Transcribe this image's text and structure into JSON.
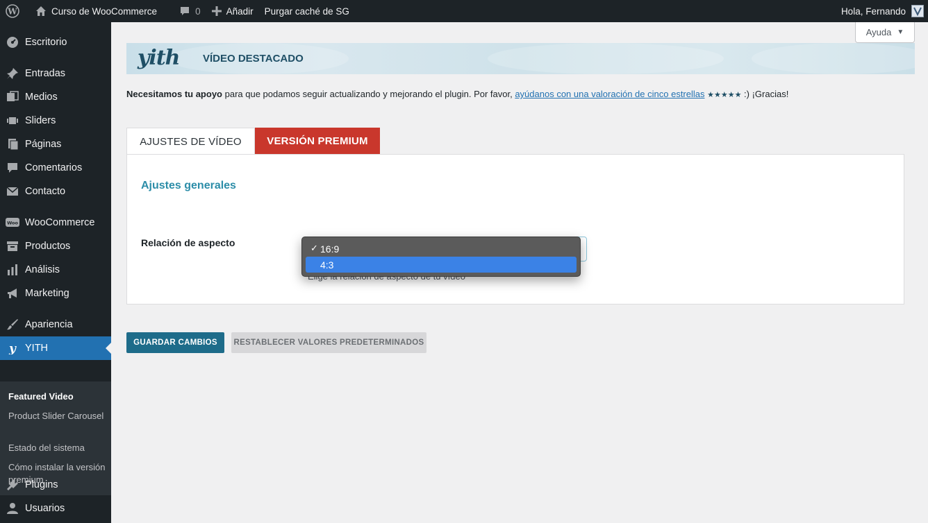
{
  "admin_bar": {
    "site_name": "Curso de WooCommerce",
    "comments_count": "0",
    "add_label": "Añadir",
    "purge_label": "Purgar caché de SG",
    "greeting": "Hola, Fernando"
  },
  "sidebar": {
    "items": [
      {
        "label": "Escritorio",
        "icon": "dashboard-icon"
      },
      {
        "label": "Entradas",
        "icon": "pin-icon"
      },
      {
        "label": "Medios",
        "icon": "media-icon"
      },
      {
        "label": "Sliders",
        "icon": "slider-icon"
      },
      {
        "label": "Páginas",
        "icon": "page-icon"
      },
      {
        "label": "Comentarios",
        "icon": "comment-icon"
      },
      {
        "label": "Contacto",
        "icon": "mail-icon"
      },
      {
        "label": "WooCommerce",
        "icon": "woo-icon"
      },
      {
        "label": "Productos",
        "icon": "archive-icon"
      },
      {
        "label": "Análisis",
        "icon": "chart-bar-icon"
      },
      {
        "label": "Marketing",
        "icon": "megaphone-icon"
      },
      {
        "label": "Apariencia",
        "icon": "brush-icon"
      },
      {
        "label": "YITH",
        "icon": "yith-icon"
      },
      {
        "label": "Plugins",
        "icon": "plugin-icon"
      },
      {
        "label": "Usuarios",
        "icon": "user-icon"
      }
    ],
    "submenu": [
      {
        "label": "Featured Video"
      },
      {
        "label": "Product Slider Carousel"
      },
      {
        "label": "Estado del sistema"
      },
      {
        "label": "Cómo instalar la versión premium"
      }
    ]
  },
  "help_tab": {
    "label": "Ayuda"
  },
  "banner": {
    "logo": "yith",
    "title": "VÍDEO DESTACADO"
  },
  "notice": {
    "bold": "Necesitamos tu apoyo",
    "text": " para que podamos seguir actualizando y mejorando el plugin. Por favor, ",
    "link": "ayúdanos con una valoración de cinco estrellas",
    "stars": "★★★★★",
    "tail": " :) ¡Gracias!"
  },
  "tabs": [
    {
      "label": "AJUSTES DE VÍDEO"
    },
    {
      "label": "VERSIÓN PREMIUM"
    }
  ],
  "settings": {
    "section_title": "Ajustes generales",
    "aspect_label": "Relación de aspecto",
    "aspect_description": "Elige la relación de aspecto de tu vídeo",
    "options": [
      {
        "label": "16:9",
        "selected": true
      },
      {
        "label": "4:3",
        "highlighted": true
      }
    ]
  },
  "buttons": {
    "save": "GUARDAR CAMBIOS",
    "reset": "RESTABLECER VALORES PREDETERMINADOS"
  },
  "colors": {
    "admin_dark": "#1d2327",
    "active_blue": "#2271b1",
    "premium_red": "#c9372c",
    "section_teal": "#2c8da8",
    "save_button": "#1e6c8a"
  }
}
